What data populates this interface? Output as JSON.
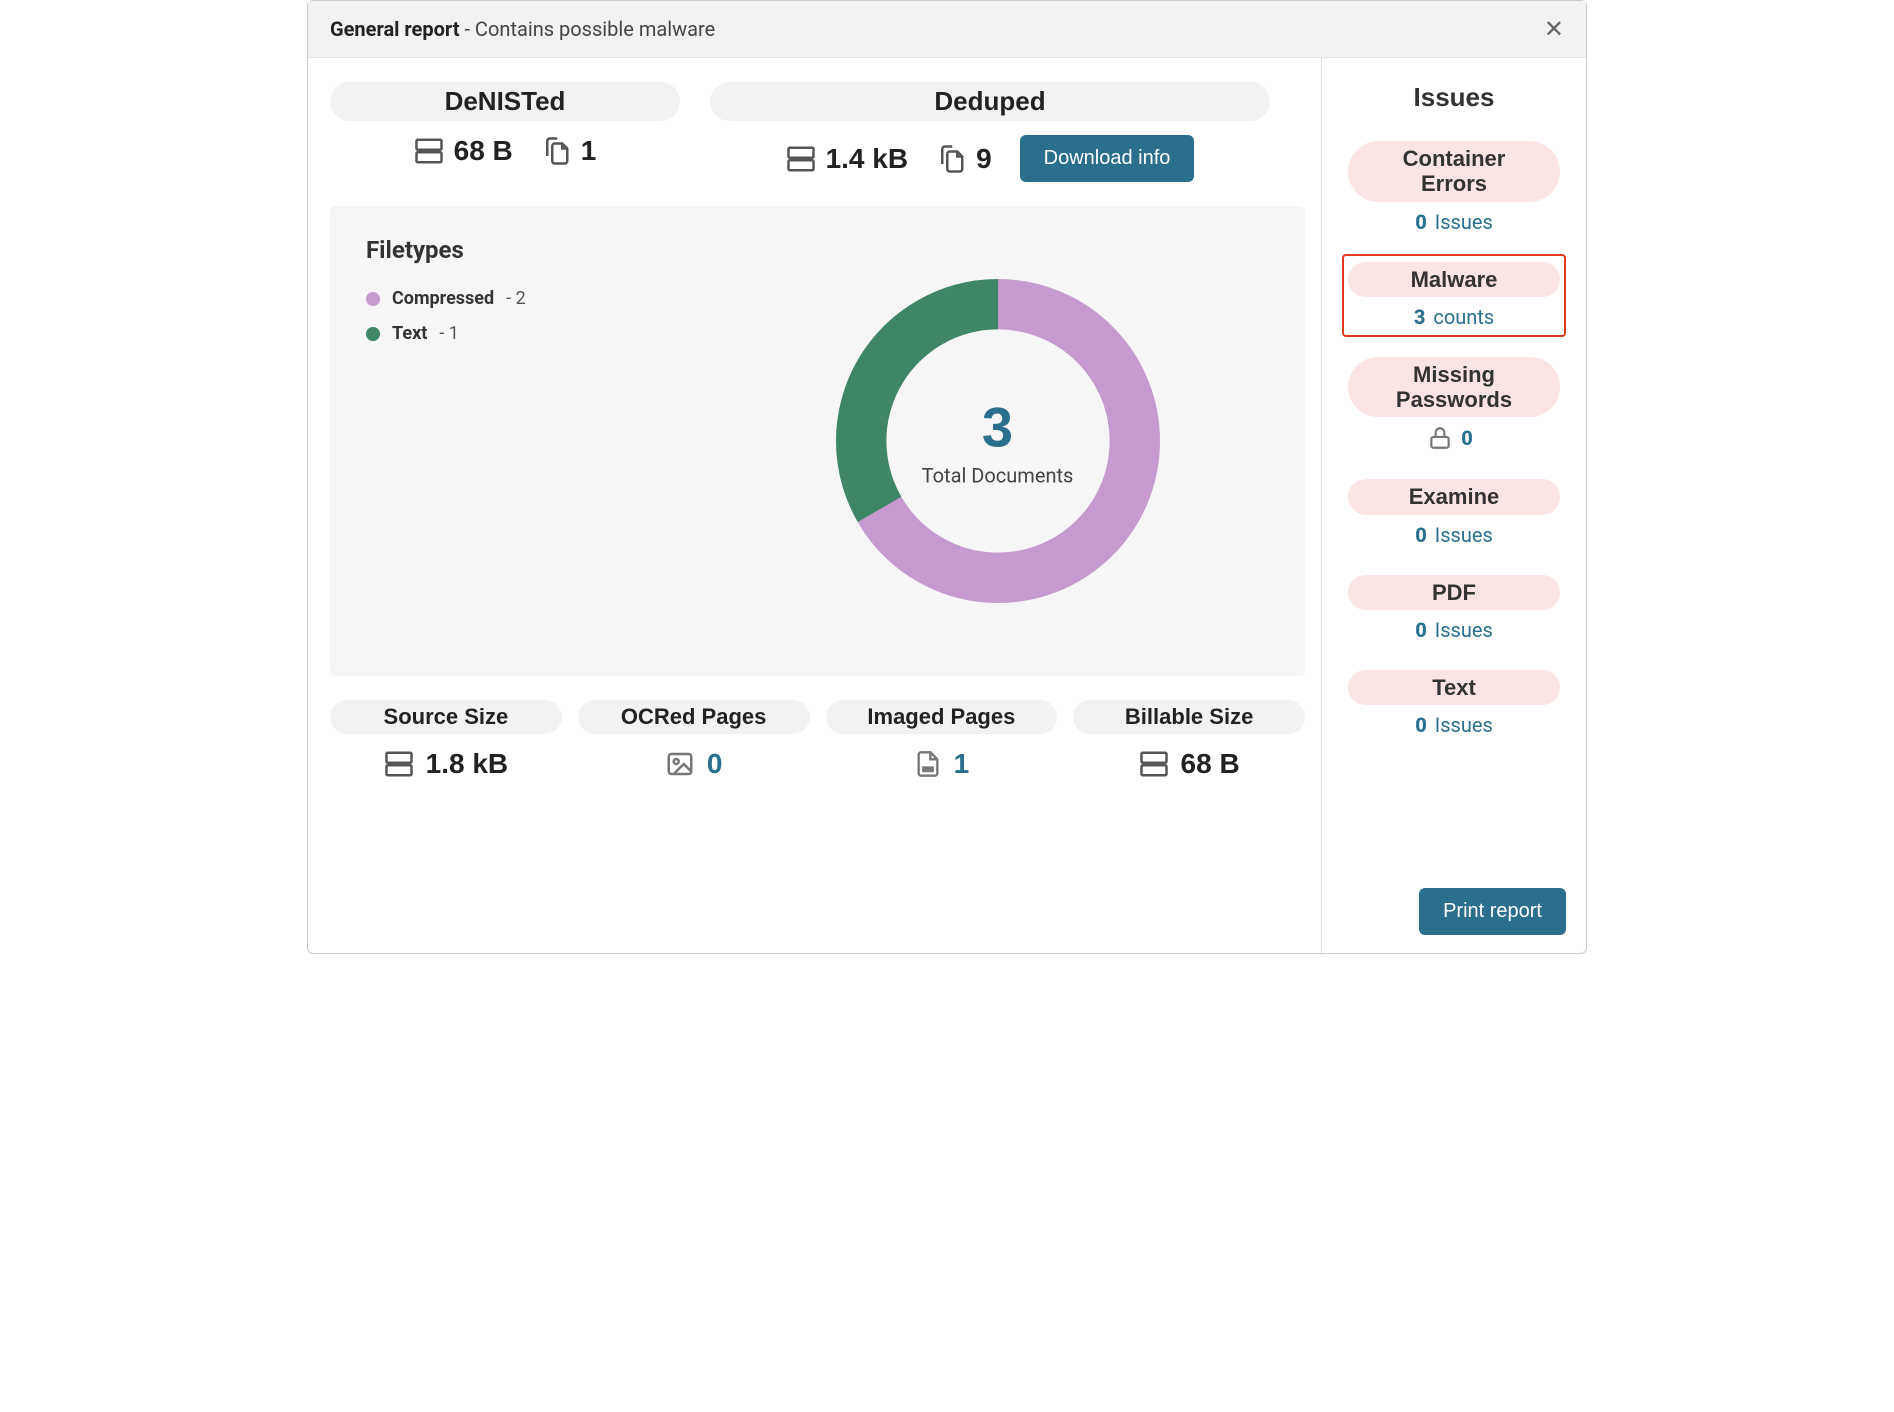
{
  "header": {
    "title_bold": "General report",
    "title_rest": " - Contains possible malware"
  },
  "top": {
    "denisted": {
      "label": "DeNISTed",
      "size": "68 B",
      "files": "1"
    },
    "deduped": {
      "label": "Deduped",
      "size": "1.4 kB",
      "files": "9",
      "download_label": "Download info"
    }
  },
  "filetypes": {
    "title": "Filetypes",
    "items": [
      {
        "name": "Compressed",
        "count": "2",
        "color": "#c59ace"
      },
      {
        "name": "Text",
        "count": "1",
        "color": "#3e8666"
      }
    ],
    "center_num": "3",
    "center_label": "Total Documents"
  },
  "bottom": [
    {
      "label": "Source Size",
      "value": "1.8 kB",
      "icon": "server",
      "accent": false
    },
    {
      "label": "OCRed Pages",
      "value": "0",
      "icon": "image",
      "accent": true
    },
    {
      "label": "Imaged Pages",
      "value": "1",
      "icon": "pdf",
      "accent": true
    },
    {
      "label": "Billable Size",
      "value": "68 B",
      "icon": "server",
      "accent": false
    }
  ],
  "sidebar": {
    "title": "Issues",
    "items": [
      {
        "label": "Container Errors",
        "count": "0",
        "unit": "Issues",
        "icon": null,
        "highlight": false
      },
      {
        "label": "Malware",
        "count": "3",
        "unit": "counts",
        "icon": null,
        "highlight": true
      },
      {
        "label": "Missing Passwords",
        "count": "0",
        "unit": "",
        "icon": "lock",
        "highlight": false
      },
      {
        "label": "Examine",
        "count": "0",
        "unit": "Issues",
        "icon": null,
        "highlight": false
      },
      {
        "label": "PDF",
        "count": "0",
        "unit": "Issues",
        "icon": null,
        "highlight": false
      },
      {
        "label": "Text",
        "count": "0",
        "unit": "Issues",
        "icon": null,
        "highlight": false
      }
    ],
    "print_label": "Print report"
  },
  "chart_data": {
    "type": "pie",
    "title": "Filetypes",
    "series": [
      {
        "name": "Compressed",
        "value": 2,
        "color": "#c59ace"
      },
      {
        "name": "Text",
        "value": 1,
        "color": "#3e8666"
      }
    ],
    "center_value": 3,
    "center_label": "Total Documents"
  }
}
